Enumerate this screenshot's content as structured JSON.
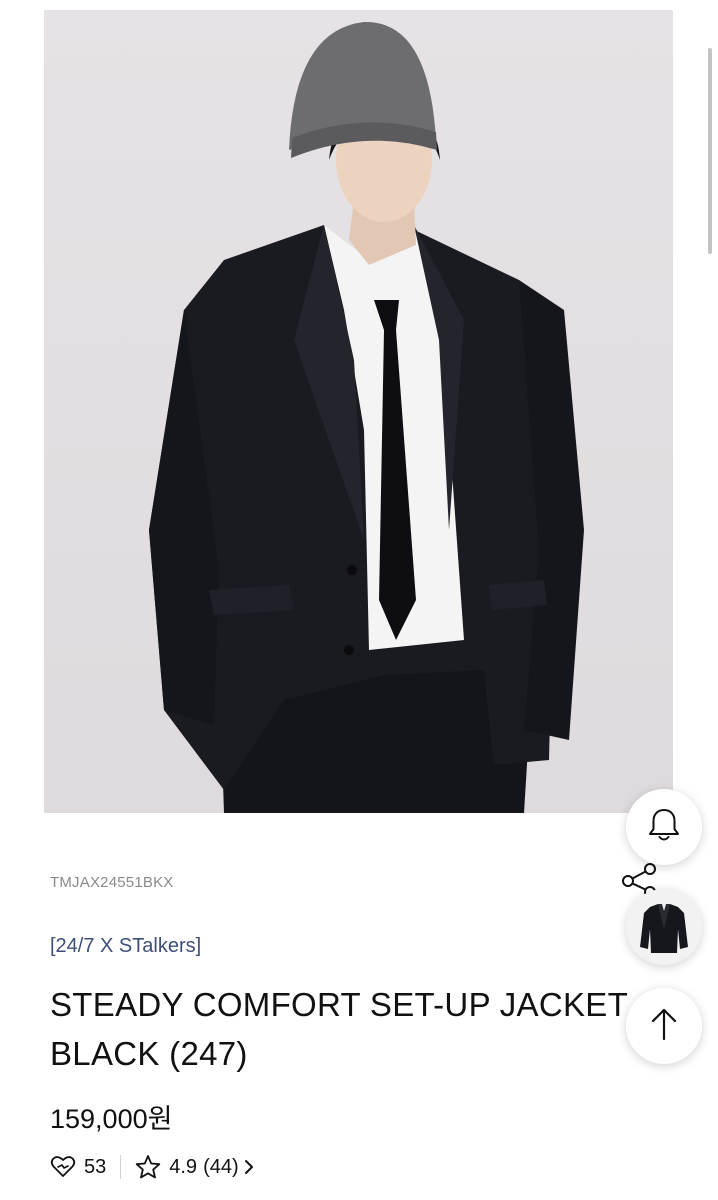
{
  "product": {
    "sku": "TMJAX24551BKX",
    "brand_line": "[24/7 X STalkers]",
    "title_line1": "STEADY COMFORT SET-UP JACKET",
    "title_line2": "BLACK (247)",
    "price": "159,000원",
    "likes": "53",
    "rating": "4.9",
    "review_count": "(44)"
  },
  "icons": {
    "notify": "bell-icon",
    "share": "share-icon",
    "scroll_top": "arrow-up-icon",
    "likes": "heart-icon",
    "rating": "star-icon",
    "more": "chevron-right-icon"
  },
  "colors": {
    "brand_link": "#3e4f7a",
    "sku": "#8a8a8a",
    "image_background": "#e2dee1"
  }
}
